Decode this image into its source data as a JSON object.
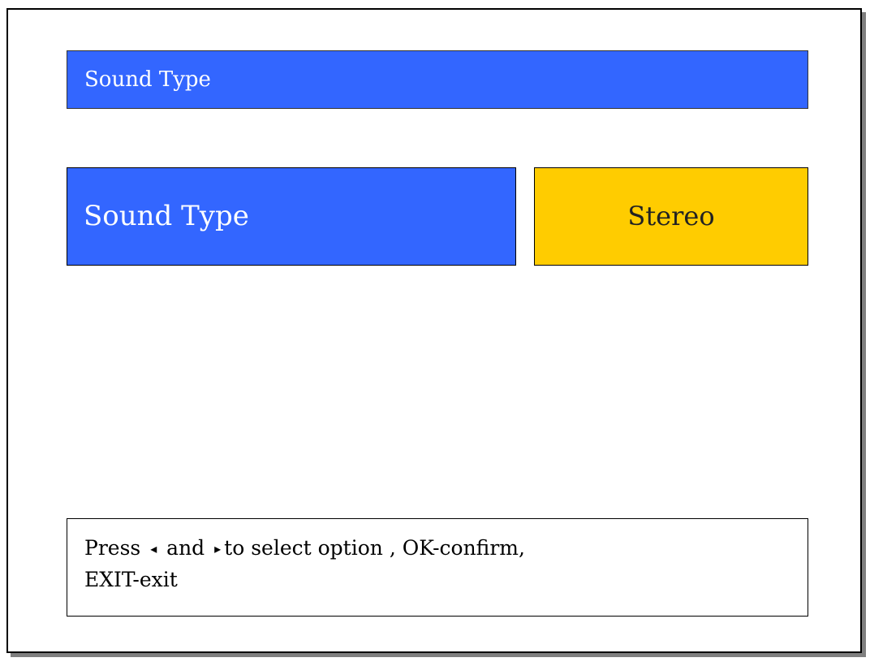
{
  "header": {
    "title": "Sound Type"
  },
  "setting": {
    "label": "Sound Type",
    "value": "Stereo"
  },
  "help": {
    "press": "Press",
    "left_arrow": "◂",
    "and": "and",
    "right_arrow": "▸",
    "rest_line1": "to select option , OK-confirm,",
    "line2": "EXIT-exit"
  },
  "colors": {
    "title_bar": "#3366ff",
    "label_box": "#3366ff",
    "value_box": "#ffcc00",
    "shadow": "#7f7f7f"
  },
  "icons": {
    "left": "triangle-left-icon",
    "right": "triangle-right-icon"
  }
}
